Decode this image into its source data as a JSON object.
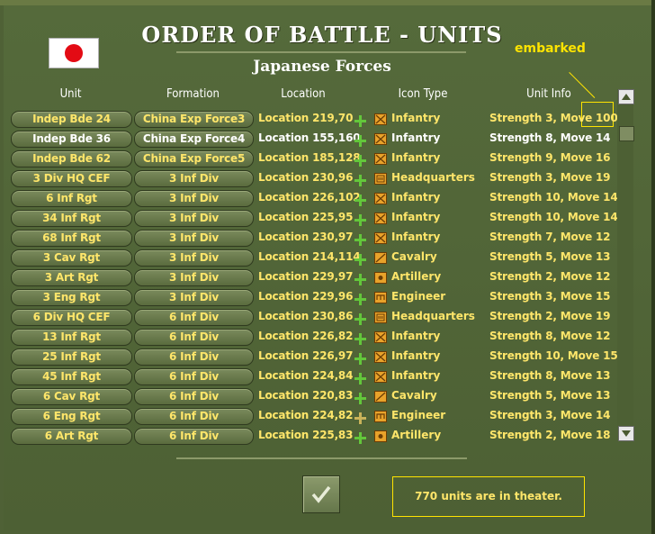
{
  "title": "ORDER OF BATTLE - UNITS",
  "subtitle": "Japanese Forces",
  "annotation": "embarked",
  "headers": {
    "unit": "Unit",
    "formation": "Formation",
    "location": "Location",
    "icon_type": "Icon Type",
    "unit_info": "Unit Info"
  },
  "colors": {
    "yellow_text": "#ffe66a",
    "white_text": "#ffffff",
    "plus_green": "#63c73b",
    "plus_tan": "#c9b35a",
    "callout": "#ffe400"
  },
  "rows": [
    {
      "unit": "Indep Bde 24",
      "formation": "China Exp Force3",
      "location": "Location 219,70",
      "icon": "infantry-icon",
      "type": "Infantry",
      "info": "Strength 3, Move 100",
      "hl": false,
      "plus": "green"
    },
    {
      "unit": "Indep Bde 36",
      "formation": "China Exp Force4",
      "location": "Location 155,160",
      "icon": "infantry-icon",
      "type": "Infantry",
      "info": "Strength 8, Move 14",
      "hl": true,
      "plus": "green"
    },
    {
      "unit": "Indep Bde 62",
      "formation": "China Exp Force5",
      "location": "Location 185,128",
      "icon": "infantry-icon",
      "type": "Infantry",
      "info": "Strength 9, Move 16",
      "hl": false,
      "plus": "green"
    },
    {
      "unit": "3 Div HQ CEF",
      "formation": "3 Inf Div",
      "location": "Location 230,96",
      "icon": "headquarters-icon",
      "type": "Headquarters",
      "info": "Strength 3, Move 19",
      "hl": false,
      "plus": "green"
    },
    {
      "unit": "6 Inf Rgt",
      "formation": "3 Inf Div",
      "location": "Location 226,102",
      "icon": "infantry-icon",
      "type": "Infantry",
      "info": "Strength 10, Move 14",
      "hl": false,
      "plus": "green"
    },
    {
      "unit": "34 Inf Rgt",
      "formation": "3 Inf Div",
      "location": "Location 225,95",
      "icon": "infantry-icon",
      "type": "Infantry",
      "info": "Strength 10, Move 14",
      "hl": false,
      "plus": "green"
    },
    {
      "unit": "68 Inf Rgt",
      "formation": "3 Inf Div",
      "location": "Location 230,97",
      "icon": "infantry-icon",
      "type": "Infantry",
      "info": "Strength 7, Move 12",
      "hl": false,
      "plus": "green"
    },
    {
      "unit": "3 Cav Rgt",
      "formation": "3 Inf Div",
      "location": "Location 214,114",
      "icon": "cavalry-icon",
      "type": "Cavalry",
      "info": "Strength 5, Move 13",
      "hl": false,
      "plus": "green"
    },
    {
      "unit": "3 Art Rgt",
      "formation": "3 Inf Div",
      "location": "Location 229,97",
      "icon": "artillery-icon",
      "type": "Artillery",
      "info": "Strength 2, Move 12",
      "hl": false,
      "plus": "green"
    },
    {
      "unit": "3 Eng Rgt",
      "formation": "3 Inf Div",
      "location": "Location 229,96",
      "icon": "engineer-icon",
      "type": "Engineer",
      "info": "Strength 3, Move 15",
      "hl": false,
      "plus": "green"
    },
    {
      "unit": "6 Div HQ CEF",
      "formation": "6 Inf Div",
      "location": "Location 230,86",
      "icon": "headquarters-icon",
      "type": "Headquarters",
      "info": "Strength 2, Move 19",
      "hl": false,
      "plus": "green"
    },
    {
      "unit": "13 Inf Rgt",
      "formation": "6 Inf Div",
      "location": "Location 226,82",
      "icon": "infantry-icon",
      "type": "Infantry",
      "info": "Strength 8, Move 12",
      "hl": false,
      "plus": "green"
    },
    {
      "unit": "25 Inf Rgt",
      "formation": "6 Inf Div",
      "location": "Location 226,97",
      "icon": "infantry-icon",
      "type": "Infantry",
      "info": "Strength 10, Move 15",
      "hl": false,
      "plus": "green"
    },
    {
      "unit": "45 Inf Rgt",
      "formation": "6 Inf Div",
      "location": "Location 224,84",
      "icon": "infantry-icon",
      "type": "Infantry",
      "info": "Strength 8, Move 13",
      "hl": false,
      "plus": "green"
    },
    {
      "unit": "6 Cav Rgt",
      "formation": "6 Inf Div",
      "location": "Location 220,83",
      "icon": "cavalry-icon",
      "type": "Cavalry",
      "info": "Strength 5, Move 13",
      "hl": false,
      "plus": "green"
    },
    {
      "unit": "6 Eng Rgt",
      "formation": "6 Inf Div",
      "location": "Location 224,82",
      "icon": "engineer-icon",
      "type": "Engineer",
      "info": "Strength 3, Move 14",
      "hl": false,
      "plus": "tan"
    },
    {
      "unit": "6 Art Rgt",
      "formation": "6 Inf Div",
      "location": "Location 225,83",
      "icon": "artillery-icon",
      "type": "Artillery",
      "info": "Strength 2, Move 18",
      "hl": false,
      "plus": "green"
    }
  ],
  "status_text": "770 units are in theater."
}
